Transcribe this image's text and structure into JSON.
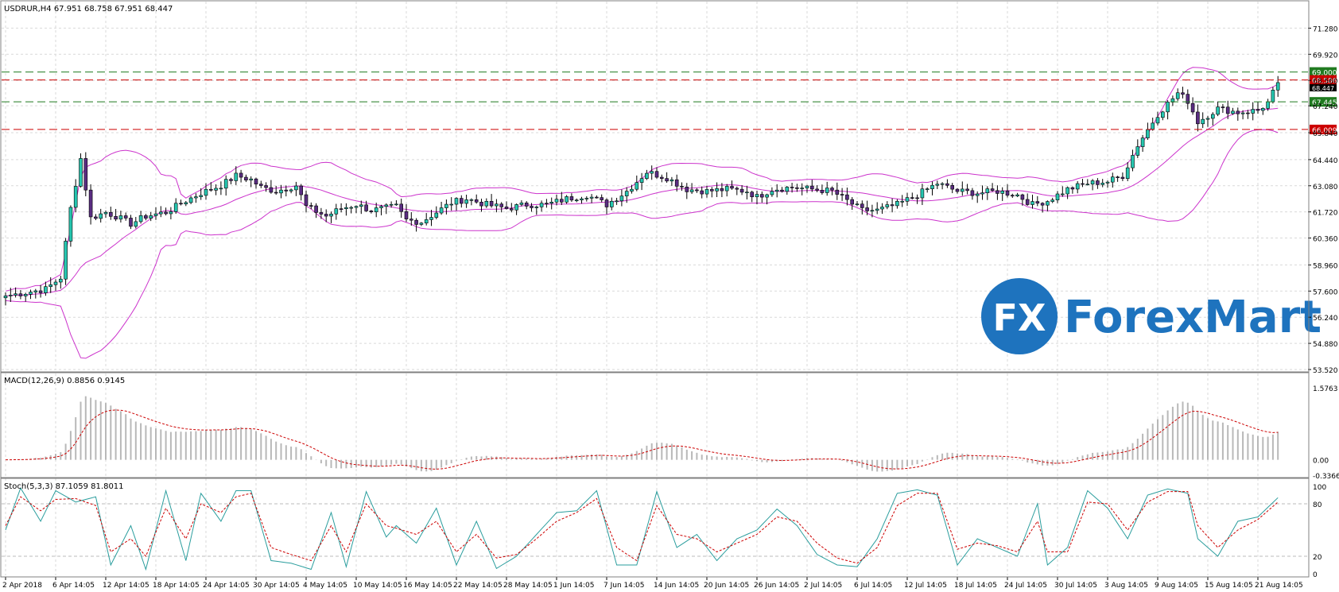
{
  "header": {
    "main_info": "USDRUR,H4  67.951 68.758 67.951 68.447",
    "macd_info": "MACD(12,26,9) 0.8856 0.9145",
    "stoch_info": "Stoch(5,3,3) 87.1059 81.8011"
  },
  "watermark": {
    "logo_mark": "FX",
    "brand": "ForexMart"
  },
  "colors": {
    "background": "#ffffff",
    "grid": "#d9d9d9",
    "bull_candle": "#26c6b0",
    "bear_candle": "#5a2d82",
    "wick": "#000000",
    "bollinger": "#cc33cc",
    "support_line": "#1f7a1f",
    "resistance_line": "#cc0000",
    "macd_hist": "#b8b8b8",
    "macd_signal": "#cc0000",
    "stoch_main": "#2a9d9d",
    "stoch_signal": "#cc0000",
    "brand_blue": "#1e73be",
    "price_tag_text": "#ffffff"
  },
  "chart_data": [
    {
      "type": "candlestick",
      "panel": "price",
      "ylim": [
        53.52,
        72.0
      ],
      "y_ticks": [
        "71.280",
        "69.920",
        "68.560",
        "67.240",
        "65.840",
        "64.440",
        "63.080",
        "61.720",
        "60.360",
        "58.960",
        "57.600",
        "56.240",
        "54.880",
        "53.520"
      ],
      "x_ticks": [
        "2 Apr 2018",
        "6 Apr 14:05",
        "12 Apr 14:05",
        "18 Apr 14:05",
        "24 Apr 14:05",
        "30 Apr 14:05",
        "4 May 14:05",
        "10 May 14:05",
        "16 May 14:05",
        "22 May 14:05",
        "28 May 14:05",
        "1 Jun 14:05",
        "7 Jun 14:05",
        "14 Jun 14:05",
        "20 Jun 14:05",
        "26 Jun 14:05",
        "2 Jul 14:05",
        "6 Jul 14:05",
        "12 Jul 14:05",
        "18 Jul 14:05",
        "24 Jul 14:05",
        "30 Jul 14:05",
        "3 Aug 14:05",
        "9 Aug 14:05",
        "15 Aug 14:05",
        "21 Aug 14:05"
      ],
      "close_anchors": [
        [
          0,
          57.35
        ],
        [
          8,
          57.7
        ],
        [
          11,
          58.3
        ],
        [
          13,
          61.9
        ],
        [
          15,
          64.5
        ],
        [
          17,
          61.4
        ],
        [
          20,
          61.7
        ],
        [
          22,
          61.5
        ],
        [
          25,
          61.1
        ],
        [
          28,
          61.5
        ],
        [
          32,
          61.7
        ],
        [
          36,
          62.3
        ],
        [
          39,
          62.7
        ],
        [
          43,
          63.1
        ],
        [
          46,
          63.6
        ],
        [
          49,
          63.4
        ],
        [
          51,
          63.0
        ],
        [
          54,
          62.8
        ],
        [
          58,
          63.1
        ],
        [
          60,
          62.0
        ],
        [
          64,
          61.5
        ],
        [
          67,
          61.9
        ],
        [
          70,
          62.1
        ],
        [
          73,
          61.8
        ],
        [
          78,
          62.0
        ],
        [
          80,
          61.3
        ],
        [
          83,
          61.2
        ],
        [
          86,
          61.7
        ],
        [
          89,
          62.2
        ],
        [
          92,
          62.4
        ],
        [
          96,
          62.1
        ],
        [
          100,
          61.9
        ],
        [
          104,
          62.1
        ],
        [
          108,
          62.1
        ],
        [
          112,
          62.4
        ],
        [
          116,
          62.6
        ],
        [
          120,
          62.1
        ],
        [
          124,
          62.8
        ],
        [
          128,
          63.8
        ],
        [
          132,
          63.5
        ],
        [
          136,
          62.9
        ],
        [
          140,
          62.8
        ],
        [
          144,
          62.9
        ],
        [
          148,
          62.8
        ],
        [
          150,
          62.5
        ],
        [
          153,
          62.9
        ],
        [
          157,
          63.0
        ],
        [
          161,
          62.9
        ],
        [
          165,
          62.8
        ],
        [
          168,
          62.3
        ],
        [
          171,
          61.8
        ],
        [
          174,
          61.8
        ],
        [
          178,
          62.1
        ],
        [
          182,
          62.6
        ],
        [
          186,
          63.2
        ],
        [
          190,
          62.8
        ],
        [
          194,
          62.7
        ],
        [
          198,
          62.8
        ],
        [
          202,
          62.6
        ],
        [
          205,
          62.1
        ],
        [
          208,
          62.3
        ],
        [
          212,
          62.9
        ],
        [
          216,
          63.2
        ],
        [
          220,
          63.3
        ],
        [
          223,
          63.6
        ],
        [
          226,
          65.2
        ],
        [
          230,
          66.8
        ],
        [
          234,
          67.9
        ],
        [
          236,
          67.5
        ],
        [
          238,
          66.4
        ],
        [
          242,
          67.1
        ],
        [
          246,
          66.9
        ],
        [
          250,
          67.0
        ],
        [
          252,
          67.4
        ],
        [
          254,
          68.45
        ]
      ],
      "bands_count": 255,
      "bollinger": "BB(20,2)"
    },
    {
      "type": "horizontal_levels",
      "levels": [
        {
          "value": 69.0,
          "label": "69.000",
          "kind": "support"
        },
        {
          "value": 68.586,
          "label": "68.586",
          "kind": "resistance"
        },
        {
          "value": 67.445,
          "label": "67.445",
          "kind": "support"
        },
        {
          "value": 66.009,
          "label": "66.009",
          "kind": "resistance"
        }
      ],
      "current_price_label": "68.447"
    },
    {
      "type": "bar+line",
      "panel": "macd",
      "title": "MACD(12,26,9) 0.8856 0.9145",
      "ylim": [
        -0.3366,
        1.5763
      ],
      "y_ticks": [
        "1.5763",
        "0.00",
        "-0.3366"
      ]
    },
    {
      "type": "line",
      "panel": "stochastic",
      "title": "Stoch(5,3,3) 87.1059 81.8011",
      "ylim": [
        0,
        100
      ],
      "y_ticks": [
        "100",
        "80",
        "20",
        "0"
      ],
      "series": [
        {
          "name": "main",
          "anchors": [
            [
              0,
              50
            ],
            [
              3,
              98
            ],
            [
              7,
              60
            ],
            [
              10,
              95
            ],
            [
              14,
              82
            ],
            [
              18,
              88
            ],
            [
              21,
              10
            ],
            [
              25,
              55
            ],
            [
              28,
              5
            ],
            [
              32,
              95
            ],
            [
              36,
              15
            ],
            [
              39,
              92
            ],
            [
              43,
              60
            ],
            [
              46,
              95
            ],
            [
              49,
              95
            ],
            [
              53,
              15
            ],
            [
              57,
              12
            ],
            [
              61,
              5
            ],
            [
              65,
              70
            ],
            [
              68,
              8
            ],
            [
              72,
              94
            ],
            [
              76,
              42
            ],
            [
              78,
              55
            ],
            [
              82,
              35
            ],
            [
              86,
              75
            ],
            [
              90,
              10
            ],
            [
              94,
              60
            ],
            [
              98,
              6
            ],
            [
              102,
              20
            ],
            [
              106,
              45
            ],
            [
              110,
              70
            ],
            [
              114,
              72
            ],
            [
              118,
              95
            ],
            [
              122,
              10
            ],
            [
              126,
              10
            ],
            [
              130,
              94
            ],
            [
              134,
              30
            ],
            [
              138,
              45
            ],
            [
              142,
              15
            ],
            [
              146,
              40
            ],
            [
              150,
              50
            ],
            [
              154,
              74
            ],
            [
              158,
              55
            ],
            [
              162,
              22
            ],
            [
              166,
              10
            ],
            [
              170,
              8
            ],
            [
              174,
              40
            ],
            [
              178,
              92
            ],
            [
              182,
              96
            ],
            [
              186,
              90
            ],
            [
              190,
              10
            ],
            [
              194,
              40
            ],
            [
              198,
              30
            ],
            [
              202,
              20
            ],
            [
              206,
              80
            ],
            [
              208,
              10
            ],
            [
              212,
              30
            ],
            [
              216,
              95
            ],
            [
              220,
              75
            ],
            [
              224,
              40
            ],
            [
              228,
              90
            ],
            [
              232,
              97
            ],
            [
              236,
              92
            ],
            [
              238,
              40
            ],
            [
              242,
              20
            ],
            [
              246,
              60
            ],
            [
              250,
              65
            ],
            [
              254,
              87
            ]
          ]
        },
        {
          "name": "signal",
          "anchors": [
            [
              0,
              55
            ],
            [
              3,
              88
            ],
            [
              7,
              72
            ],
            [
              10,
              85
            ],
            [
              14,
              86
            ],
            [
              18,
              78
            ],
            [
              21,
              25
            ],
            [
              25,
              40
            ],
            [
              28,
              20
            ],
            [
              32,
              75
            ],
            [
              36,
              40
            ],
            [
              39,
              80
            ],
            [
              43,
              70
            ],
            [
              46,
              88
            ],
            [
              49,
              92
            ],
            [
              53,
              30
            ],
            [
              57,
              22
            ],
            [
              61,
              15
            ],
            [
              65,
              55
            ],
            [
              68,
              25
            ],
            [
              72,
              80
            ],
            [
              76,
              55
            ],
            [
              78,
              52
            ],
            [
              82,
              45
            ],
            [
              86,
              60
            ],
            [
              90,
              25
            ],
            [
              94,
              45
            ],
            [
              98,
              18
            ],
            [
              102,
              22
            ],
            [
              106,
              40
            ],
            [
              110,
              60
            ],
            [
              114,
              70
            ],
            [
              118,
              86
            ],
            [
              122,
              30
            ],
            [
              126,
              15
            ],
            [
              130,
              78
            ],
            [
              134,
              45
            ],
            [
              138,
              40
            ],
            [
              142,
              25
            ],
            [
              146,
              35
            ],
            [
              150,
              45
            ],
            [
              154,
              65
            ],
            [
              158,
              60
            ],
            [
              162,
              35
            ],
            [
              166,
              18
            ],
            [
              170,
              12
            ],
            [
              174,
              30
            ],
            [
              178,
              78
            ],
            [
              182,
              92
            ],
            [
              186,
              92
            ],
            [
              190,
              28
            ],
            [
              194,
              35
            ],
            [
              198,
              32
            ],
            [
              202,
              25
            ],
            [
              206,
              60
            ],
            [
              208,
              25
            ],
            [
              212,
              25
            ],
            [
              216,
              82
            ],
            [
              220,
              80
            ],
            [
              224,
              50
            ],
            [
              228,
              82
            ],
            [
              232,
              94
            ],
            [
              236,
              94
            ],
            [
              238,
              55
            ],
            [
              242,
              30
            ],
            [
              246,
              50
            ],
            [
              250,
              62
            ],
            [
              254,
              82
            ]
          ]
        }
      ]
    }
  ]
}
